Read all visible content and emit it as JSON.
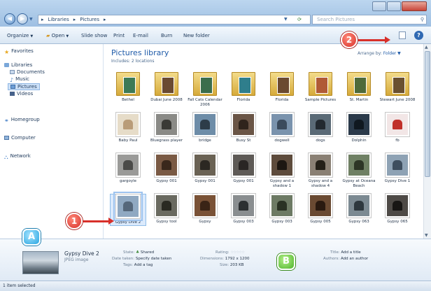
{
  "window": {
    "breadcrumb": [
      "Libraries",
      "Pictures"
    ],
    "search_placeholder": "Search Pictures"
  },
  "toolbar": {
    "organize": "Organize",
    "open": "Open",
    "slideshow": "Slide show",
    "print": "Print",
    "email": "E-mail",
    "burn": "Burn",
    "new_folder": "New folder"
  },
  "navpane": {
    "favorites": "Favorites",
    "libraries": "Libraries",
    "documents": "Documents",
    "music": "Music",
    "pictures": "Pictures",
    "videos": "Videos",
    "homegroup": "Homegroup",
    "computer": "Computer",
    "network": "Network"
  },
  "library": {
    "title": "Pictures library",
    "subtitle": "Includes: 2 locations",
    "arrange_label": "Arrange by:",
    "arrange_value": "Folder"
  },
  "items": [
    {
      "name": "Bethel",
      "type": "folder",
      "color": "#3d7a56"
    },
    {
      "name": "Dubai June 2008",
      "type": "folder",
      "color": "#6a4a32"
    },
    {
      "name": "Fall Cats Calendar 2006",
      "type": "folder",
      "color": "#3b6e4c"
    },
    {
      "name": "Florida",
      "type": "folder",
      "color": "#2f7e8c"
    },
    {
      "name": "Florida",
      "type": "folder",
      "color": "#6b4a30"
    },
    {
      "name": "Sample Pictures",
      "type": "folder",
      "color": "#b05a36"
    },
    {
      "name": "St. Martin",
      "type": "folder",
      "color": "#4e6a3a"
    },
    {
      "name": "Stewart June 2008",
      "type": "folder",
      "color": "#6a5030"
    },
    {
      "name": "Baby Paul",
      "type": "photo",
      "color": "#e6dcc8",
      "inner": "#b99c78"
    },
    {
      "name": "Bluegrass player",
      "type": "photo",
      "color": "#8a8a86",
      "inner": "#3a3a36"
    },
    {
      "name": "bridge",
      "type": "photo",
      "color": "#6e8da8",
      "inner": "#2d3c49"
    },
    {
      "name": "Busy St",
      "type": "photo",
      "color": "#6a5546",
      "inner": "#2f241c"
    },
    {
      "name": "dogwell",
      "type": "photo",
      "color": "#7a93ad",
      "inner": "#3b4b5d"
    },
    {
      "name": "dogs",
      "type": "photo",
      "color": "#5a6a76",
      "inner": "#22292f"
    },
    {
      "name": "Dolphin",
      "type": "photo",
      "color": "#2b3a4a",
      "inner": "#101820"
    },
    {
      "name": "fb",
      "type": "photo",
      "color": "#f2e6e6",
      "inner": "#c0302a"
    },
    {
      "name": "gargoyle",
      "type": "photo",
      "color": "#9a9a98",
      "inner": "#4a4a48"
    },
    {
      "name": "Gypsy 001",
      "type": "photo",
      "color": "#7a5a44",
      "inner": "#3a281c"
    },
    {
      "name": "Gypsy 001",
      "type": "photo",
      "color": "#6a6254",
      "inner": "#2c2822"
    },
    {
      "name": "Gypsy 001",
      "type": "photo",
      "color": "#5e5a56",
      "inner": "#2a2624"
    },
    {
      "name": "Gypsy and a shadow 1",
      "type": "photo",
      "color": "#5d4b3c",
      "inner": "#1d1712"
    },
    {
      "name": "Gypsy and a shadow 4",
      "type": "photo",
      "color": "#8a8074",
      "inner": "#242018"
    },
    {
      "name": "Gypsy at Oceana Beach",
      "type": "photo",
      "color": "#6f8064",
      "inner": "#2d3526"
    },
    {
      "name": "Gypsy Dive 1",
      "type": "photo",
      "color": "#8ea2b4",
      "inner": "#3e4e5e"
    },
    {
      "name": "Gypsy Dive 2",
      "type": "photo",
      "color": "#90a9c2",
      "inner": "#55677a",
      "selected": true
    },
    {
      "name": "Gypsy tool",
      "type": "photo",
      "color": "#6a6a60",
      "inner": "#2a2a22"
    },
    {
      "name": "Gypsy",
      "type": "photo",
      "color": "#7a5236",
      "inner": "#3a2416"
    },
    {
      "name": "Gypsy 003",
      "type": "photo",
      "color": "#8a8e90",
      "inner": "#2c3032"
    },
    {
      "name": "Gypsy 003",
      "type": "photo",
      "color": "#6d7a64",
      "inner": "#2a3224"
    },
    {
      "name": "Gypsy 005",
      "type": "photo",
      "color": "#6a4a32",
      "inner": "#2a1a10"
    },
    {
      "name": "Gypsy 063",
      "type": "photo",
      "color": "#7c8a92",
      "inner": "#2e383e"
    },
    {
      "name": "Gypsy 065",
      "type": "photo",
      "color": "#4e4a46",
      "inner": "#181614"
    }
  ],
  "details": {
    "name": "Gypsy Dive 2",
    "type": "JPEG image",
    "state_label": "State:",
    "state_value": "Shared",
    "date_label": "Date taken:",
    "date_value": "Specify date taken",
    "tags_label": "Tags:",
    "tags_value": "Add a tag",
    "rating_label": "Rating:",
    "dimensions_label": "Dimensions:",
    "dimensions_value": "1792 x 1200",
    "size_label": "Size:",
    "size_value": "203 KB",
    "title_label": "Title:",
    "title_value": "Add a title",
    "authors_label": "Authors:",
    "authors_value": "Add an author"
  },
  "status": {
    "text": "1 item selected"
  },
  "callouts": {
    "one": "1",
    "two": "2",
    "a": "A",
    "b": "B"
  },
  "colors": {
    "accent": "#1e5aa8",
    "callout_red": "#d8302a",
    "callout_blue": "#2aa5e0",
    "callout_green": "#4fb52c"
  }
}
